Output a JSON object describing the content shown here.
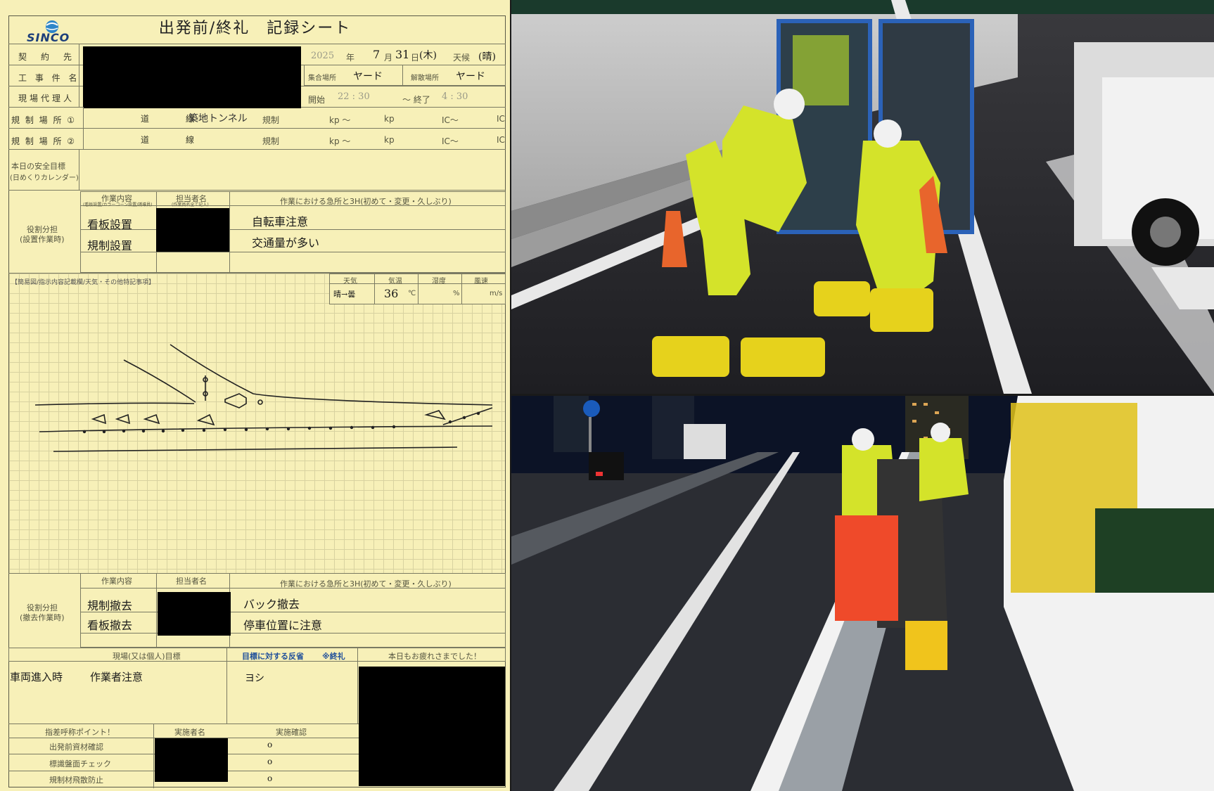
{
  "sheet": {
    "logo": "SINCO",
    "title": "出発前/終礼　記録シート",
    "rows": {
      "contractor": "契　約　先",
      "project": "工 事 件 名",
      "site_agent": "現場代理人",
      "reg1": "規 制 場 所 ①",
      "reg2": "規 制 場 所 ②",
      "safety_goal": "本日の安全目標",
      "safety_goal_sub": "(日めくりカレンダー)"
    },
    "date": {
      "year": "2025",
      "year_unit": "年",
      "month": "7",
      "month_unit": "月",
      "day": "31",
      "day_unit": "日",
      "weekday": "(木)",
      "weather_label": "天候",
      "weather": "(晴)"
    },
    "assembly_label": "集合場所",
    "assembly_value": "ヤード",
    "dismiss_label": "解散場所",
    "dismiss_value": "ヤード",
    "start_label": "開始",
    "start_value": "22 : 30",
    "end_sep": "〜 終了",
    "end_value": "4 : 30",
    "road_label": "道　　　線",
    "road1_hand": "築地トンネル",
    "reg_label": "規制",
    "kp_label": "kp 〜",
    "kp_label2": "kp",
    "ic_label": "IC〜",
    "ic_label2": "IC",
    "setup": {
      "role_title": "役割分担",
      "role_sub": "(設置作業時)",
      "col_work": "作業内容",
      "col_person": "担当者名",
      "col_note": "作業における急所と3H(初めて・変更・久しぶり)",
      "col_work_sub": "(看板設置/カラーコーン設置/誘導員)",
      "col_person_sub": "(作業員名全て記入)",
      "work1": "看板設置",
      "work2": "規制設置",
      "note1": "自転車注意",
      "note2": "交通量が多い"
    },
    "memo_label": "【簡易図/指示内容記載欄/天気・その他特記事項】",
    "weather_cols": {
      "weather": "天気",
      "temp": "気温",
      "humidity": "湿度",
      "wind": "風速"
    },
    "weather_vals": {
      "weather": "晴→曇",
      "temp": "36",
      "temp_unit": "℃",
      "hum_unit": "%",
      "wind_unit": "m/s"
    },
    "removal": {
      "role_title": "役割分担",
      "role_sub": "(撤去作業時)",
      "col_work": "作業内容",
      "col_person": "担当者名",
      "col_note": "作業における急所と3H(初めて・変更・久しぶり)",
      "work1": "規制撤去",
      "work2": "看板撤去",
      "note1": "バック撤去",
      "note2": "停車位置に注意"
    },
    "goal_row": {
      "col_goal": "現場(又は個人)目標",
      "col_reflect": "目標に対する反省",
      "col_closing": "※終礼",
      "col_thanks": "本日もお疲れさまでした！",
      "goal_hand_a": "車両進入時",
      "goal_hand_b": "作業者注意",
      "reflect_hand": "ヨシ"
    },
    "check": {
      "col_point": "指差呼称ポイント！",
      "col_person": "実施者名",
      "col_confirm": "実施確認",
      "item1": "出発前資材確認",
      "item2": "標識盤面チェック",
      "item3": "規制材飛散防止",
      "mark": "o"
    }
  },
  "photos": {
    "top": "tunnel-crew-setting-sign",
    "bottom": "highway-night-lane-closure"
  }
}
